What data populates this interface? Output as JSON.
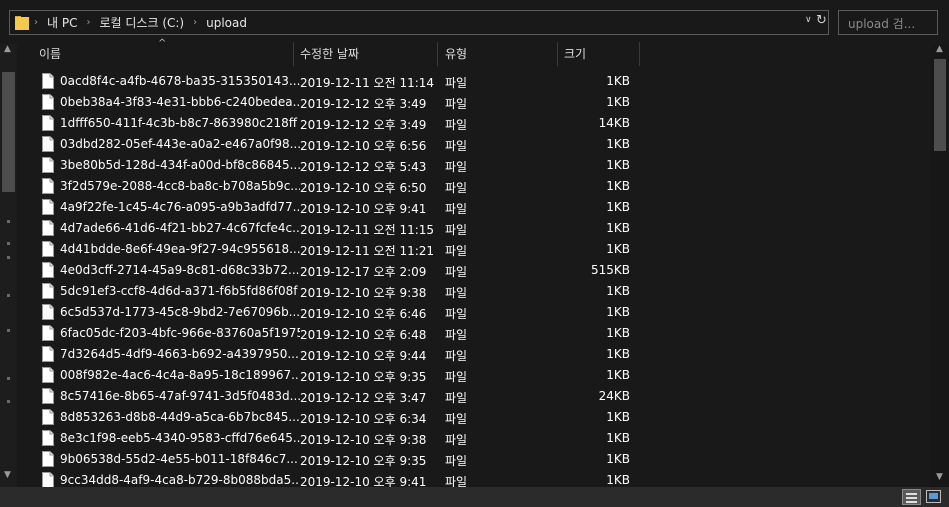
{
  "address": {
    "crumbs": [
      "내 PC",
      "로컬 디스크 (C:)",
      "upload"
    ]
  },
  "search": {
    "placeholder": "upload 검..."
  },
  "columns": {
    "name": "이름",
    "date": "수정한 날짜",
    "type": "유형",
    "size": "크기"
  },
  "icons": {
    "folder": "folder-icon",
    "file": "file-icon",
    "refresh": "refresh-icon",
    "dropdown": "chevron-down-icon"
  },
  "files": [
    {
      "name": "0acd8f4c-a4fb-4678-ba35-315350143...",
      "date": "2019-12-11 오전 11:14",
      "type": "파일",
      "size": "1KB"
    },
    {
      "name": "0beb38a4-3f83-4e31-bbb6-c240bedea...",
      "date": "2019-12-12 오후 3:49",
      "type": "파일",
      "size": "1KB"
    },
    {
      "name": "1dfff650-411f-4c3b-b8c7-863980c218ff",
      "date": "2019-12-12 오후 3:49",
      "type": "파일",
      "size": "14KB"
    },
    {
      "name": "03dbd282-05ef-443e-a0a2-e467a0f98...",
      "date": "2019-12-10 오후 6:56",
      "type": "파일",
      "size": "1KB"
    },
    {
      "name": "3be80b5d-128d-434f-a00d-bf8c86845...",
      "date": "2019-12-12 오후 5:43",
      "type": "파일",
      "size": "1KB"
    },
    {
      "name": "3f2d579e-2088-4cc8-ba8c-b708a5b9c...",
      "date": "2019-12-10 오후 6:50",
      "type": "파일",
      "size": "1KB"
    },
    {
      "name": "4a9f22fe-1c45-4c76-a095-a9b3adfd77...",
      "date": "2019-12-10 오후 9:41",
      "type": "파일",
      "size": "1KB"
    },
    {
      "name": "4d7ade66-41d6-4f21-bb27-4c67fcfe4c...",
      "date": "2019-12-11 오전 11:15",
      "type": "파일",
      "size": "1KB"
    },
    {
      "name": "4d41bdde-8e6f-49ea-9f27-94c955618...",
      "date": "2019-12-11 오전 11:21",
      "type": "파일",
      "size": "1KB"
    },
    {
      "name": "4e0d3cff-2714-45a9-8c81-d68c33b72...",
      "date": "2019-12-17 오후 2:09",
      "type": "파일",
      "size": "515KB"
    },
    {
      "name": "5dc91ef3-ccf8-4d6d-a371-f6b5fd86f08f",
      "date": "2019-12-10 오후 9:38",
      "type": "파일",
      "size": "1KB"
    },
    {
      "name": "6c5d537d-1773-45c8-9bd2-7e67096b...",
      "date": "2019-12-10 오후 6:46",
      "type": "파일",
      "size": "1KB"
    },
    {
      "name": "6fac05dc-f203-4bfc-966e-83760a5f1975",
      "date": "2019-12-10 오후 6:48",
      "type": "파일",
      "size": "1KB"
    },
    {
      "name": "7d3264d5-4df9-4663-b692-a4397950...",
      "date": "2019-12-10 오후 9:44",
      "type": "파일",
      "size": "1KB"
    },
    {
      "name": "008f982e-4ac6-4c4a-8a95-18c189967...",
      "date": "2019-12-10 오후 9:35",
      "type": "파일",
      "size": "1KB"
    },
    {
      "name": "8c57416e-8b65-47af-9741-3d5f0483d...",
      "date": "2019-12-12 오후 3:47",
      "type": "파일",
      "size": "24KB"
    },
    {
      "name": "8d853263-d8b8-44d9-a5ca-6b7bc845...",
      "date": "2019-12-10 오후 6:34",
      "type": "파일",
      "size": "1KB"
    },
    {
      "name": "8e3c1f98-eeb5-4340-9583-cffd76e645...",
      "date": "2019-12-10 오후 9:38",
      "type": "파일",
      "size": "1KB"
    },
    {
      "name": "9b06538d-55d2-4e55-b011-18f846c7...",
      "date": "2019-12-10 오후 9:35",
      "type": "파일",
      "size": "1KB"
    },
    {
      "name": "9cc34dd8-4af9-4ca8-b729-8b088bda5...",
      "date": "2019-12-10 오후 9:41",
      "type": "파일",
      "size": "1KB"
    }
  ],
  "colors": {
    "background": "#191919",
    "text": "#ffffff",
    "folder": "#f2c94c",
    "accent": "#5b9bd5"
  }
}
